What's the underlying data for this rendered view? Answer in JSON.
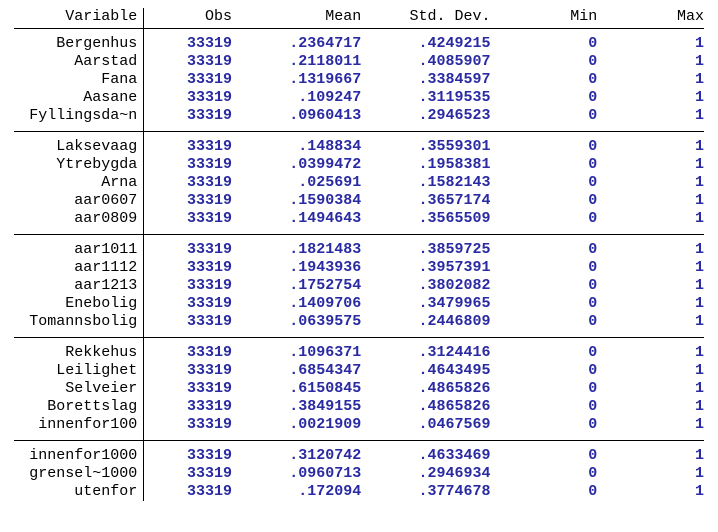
{
  "headers": {
    "variable": "Variable",
    "obs": "Obs",
    "mean": "Mean",
    "sd": "Std. Dev.",
    "min": "Min",
    "max": "Max"
  },
  "groups": [
    [
      {
        "var": "Bergenhus",
        "obs": "33319",
        "mean": ".2364717",
        "sd": ".4249215",
        "min": "0",
        "max": "1"
      },
      {
        "var": "Aarstad",
        "obs": "33319",
        "mean": ".2118011",
        "sd": ".4085907",
        "min": "0",
        "max": "1"
      },
      {
        "var": "Fana",
        "obs": "33319",
        "mean": ".1319667",
        "sd": ".3384597",
        "min": "0",
        "max": "1"
      },
      {
        "var": "Aasane",
        "obs": "33319",
        "mean": ".109247",
        "sd": ".3119535",
        "min": "0",
        "max": "1"
      },
      {
        "var": "Fyllingsda~n",
        "obs": "33319",
        "mean": ".0960413",
        "sd": ".2946523",
        "min": "0",
        "max": "1"
      }
    ],
    [
      {
        "var": "Laksevaag",
        "obs": "33319",
        "mean": ".148834",
        "sd": ".3559301",
        "min": "0",
        "max": "1"
      },
      {
        "var": "Ytrebygda",
        "obs": "33319",
        "mean": ".0399472",
        "sd": ".1958381",
        "min": "0",
        "max": "1"
      },
      {
        "var": "Arna",
        "obs": "33319",
        "mean": ".025691",
        "sd": ".1582143",
        "min": "0",
        "max": "1"
      },
      {
        "var": "aar0607",
        "obs": "33319",
        "mean": ".1590384",
        "sd": ".3657174",
        "min": "0",
        "max": "1"
      },
      {
        "var": "aar0809",
        "obs": "33319",
        "mean": ".1494643",
        "sd": ".3565509",
        "min": "0",
        "max": "1"
      }
    ],
    [
      {
        "var": "aar1011",
        "obs": "33319",
        "mean": ".1821483",
        "sd": ".3859725",
        "min": "0",
        "max": "1"
      },
      {
        "var": "aar1112",
        "obs": "33319",
        "mean": ".1943936",
        "sd": ".3957391",
        "min": "0",
        "max": "1"
      },
      {
        "var": "aar1213",
        "obs": "33319",
        "mean": ".1752754",
        "sd": ".3802082",
        "min": "0",
        "max": "1"
      },
      {
        "var": "Enebolig",
        "obs": "33319",
        "mean": ".1409706",
        "sd": ".3479965",
        "min": "0",
        "max": "1"
      },
      {
        "var": "Tomannsbolig",
        "obs": "33319",
        "mean": ".0639575",
        "sd": ".2446809",
        "min": "0",
        "max": "1"
      }
    ],
    [
      {
        "var": "Rekkehus",
        "obs": "33319",
        "mean": ".1096371",
        "sd": ".3124416",
        "min": "0",
        "max": "1"
      },
      {
        "var": "Leilighet",
        "obs": "33319",
        "mean": ".6854347",
        "sd": ".4643495",
        "min": "0",
        "max": "1"
      },
      {
        "var": "Selveier",
        "obs": "33319",
        "mean": ".6150845",
        "sd": ".4865826",
        "min": "0",
        "max": "1"
      },
      {
        "var": "Borettslag",
        "obs": "33319",
        "mean": ".3849155",
        "sd": ".4865826",
        "min": "0",
        "max": "1"
      },
      {
        "var": "innenfor100",
        "obs": "33319",
        "mean": ".0021909",
        "sd": ".0467569",
        "min": "0",
        "max": "1"
      }
    ],
    [
      {
        "var": "innenfor1000",
        "obs": "33319",
        "mean": ".3120742",
        "sd": ".4633469",
        "min": "0",
        "max": "1"
      },
      {
        "var": "grensel~1000",
        "obs": "33319",
        "mean": ".0960713",
        "sd": ".2946934",
        "min": "0",
        "max": "1"
      },
      {
        "var": "utenfor",
        "obs": "33319",
        "mean": ".172094",
        "sd": ".3774678",
        "min": "0",
        "max": "1"
      }
    ]
  ]
}
